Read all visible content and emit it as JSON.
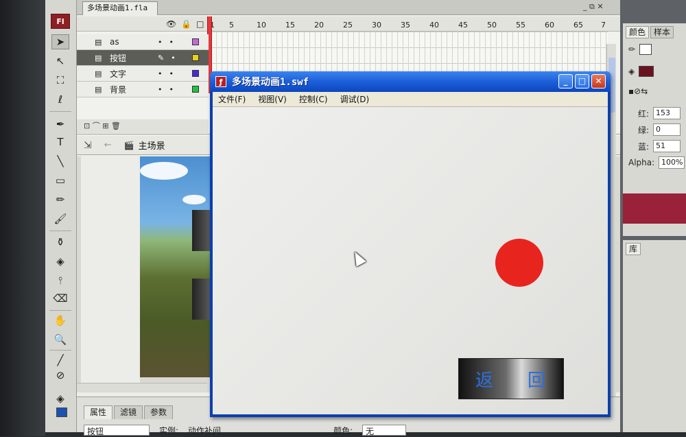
{
  "ide": {
    "app_logo": "Fl",
    "document_tab": "多场景动画1.fla",
    "doc_controls": "_ ⧉ ✕"
  },
  "timeline": {
    "header_icons": "👁🔒□",
    "frame_numbers": [
      "1",
      "5",
      "10",
      "15",
      "20",
      "25",
      "30",
      "35",
      "40",
      "45",
      "50",
      "55",
      "60",
      "65",
      "7"
    ],
    "layers": [
      {
        "name": "as",
        "color": "#c46ad6"
      },
      {
        "name": "按钮",
        "color": "#e7d21b"
      },
      {
        "name": "文字",
        "color": "#4b2ad4"
      },
      {
        "name": "背景",
        "color": "#22c23c"
      }
    ],
    "footer_icons": "⊡ ⌒ ⊞ 🗑"
  },
  "editbar": {
    "scene_name": "主场景"
  },
  "properties": {
    "tabs": [
      "属性",
      "滤镜",
      "参数"
    ],
    "symbol_type": "按钮",
    "instance_label": "实例:",
    "instance_value": "动作补间",
    "color_label": "颜色:",
    "color_value": "无"
  },
  "color_panel": {
    "tabs": [
      "颜色",
      "样本"
    ],
    "red_label": "红:",
    "red_value": "153",
    "green_label": "绿:",
    "green_value": "0",
    "blue_label": "蓝:",
    "blue_value": "51",
    "alpha_label": "Alpha:",
    "alpha_value": "100%",
    "preview_color": "#99213a"
  },
  "library_panel": {
    "tab": "库"
  },
  "swf_window": {
    "title": "多场景动画1.swf",
    "menu": [
      "文件(F)",
      "视图(V)",
      "控制(C)",
      "调试(D)"
    ],
    "return_button_chars": [
      "返",
      "回"
    ],
    "ball_color": "#e8241f"
  }
}
